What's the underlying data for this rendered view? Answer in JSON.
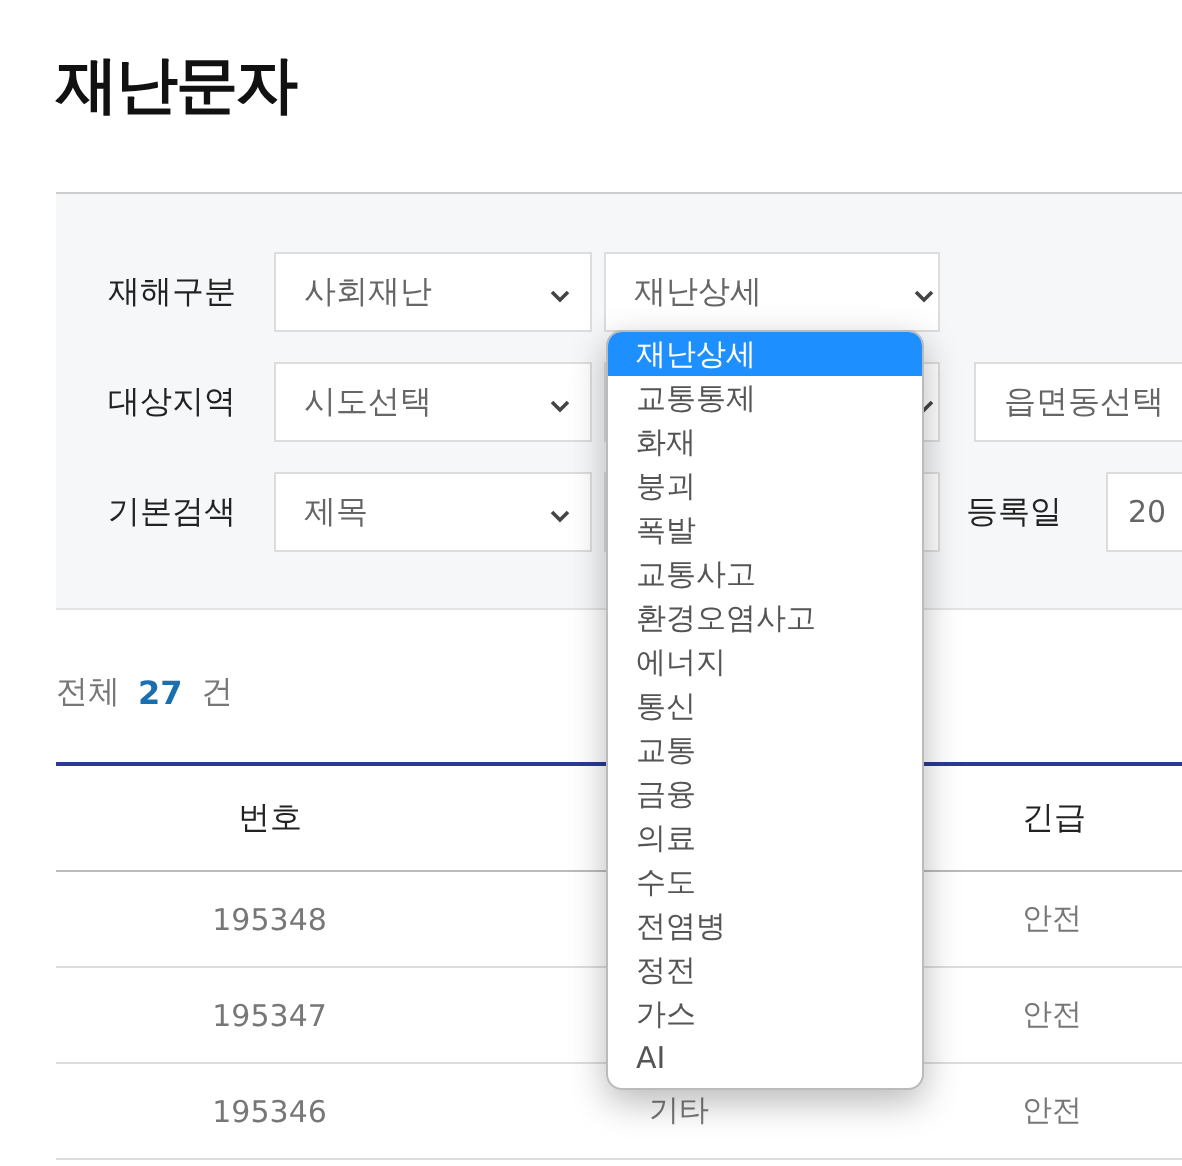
{
  "page_title": "재난문자",
  "filters": [
    {
      "label": "재해구분",
      "controls": [
        {
          "kind": "select",
          "value": "사회재난",
          "expanded": false
        },
        {
          "kind": "select",
          "value": "재난상세",
          "expanded": true
        }
      ]
    },
    {
      "label": "대상지역",
      "controls": [
        {
          "kind": "select",
          "value": "시도선택",
          "expanded": false
        },
        {
          "kind": "select",
          "expanded": false
        },
        {
          "kind": "select",
          "value": "읍면동선택",
          "expanded": false
        }
      ]
    },
    {
      "label": "기본검색",
      "controls": [
        {
          "kind": "select",
          "value": "제목",
          "expanded": false
        },
        {
          "kind": "input"
        },
        {
          "kind": "label",
          "value": "등록일"
        },
        {
          "kind": "input",
          "value": "20"
        }
      ]
    }
  ],
  "dropdown_options": [
    {
      "label": "재난상세",
      "selected": true
    },
    {
      "label": "교통통제",
      "selected": false
    },
    {
      "label": "화재",
      "selected": false
    },
    {
      "label": "붕괴",
      "selected": false
    },
    {
      "label": "폭발",
      "selected": false
    },
    {
      "label": "교통사고",
      "selected": false
    },
    {
      "label": "환경오염사고",
      "selected": false
    },
    {
      "label": "에너지",
      "selected": false
    },
    {
      "label": "통신",
      "selected": false
    },
    {
      "label": "교통",
      "selected": false
    },
    {
      "label": "금융",
      "selected": false
    },
    {
      "label": "의료",
      "selected": false
    },
    {
      "label": "수도",
      "selected": false
    },
    {
      "label": "전염병",
      "selected": false
    },
    {
      "label": "정전",
      "selected": false
    },
    {
      "label": "가스",
      "selected": false
    },
    {
      "label": "AI",
      "selected": false
    }
  ],
  "result_count": {
    "prefix": "전체",
    "count": "27",
    "suffix": "건"
  },
  "table": {
    "columns": [
      "번호",
      null,
      "긴급"
    ],
    "rows": [
      [
        "195348",
        null,
        "안전"
      ],
      [
        "195347",
        null,
        "안전"
      ],
      [
        "195346",
        "기타",
        "안전"
      ]
    ]
  }
}
